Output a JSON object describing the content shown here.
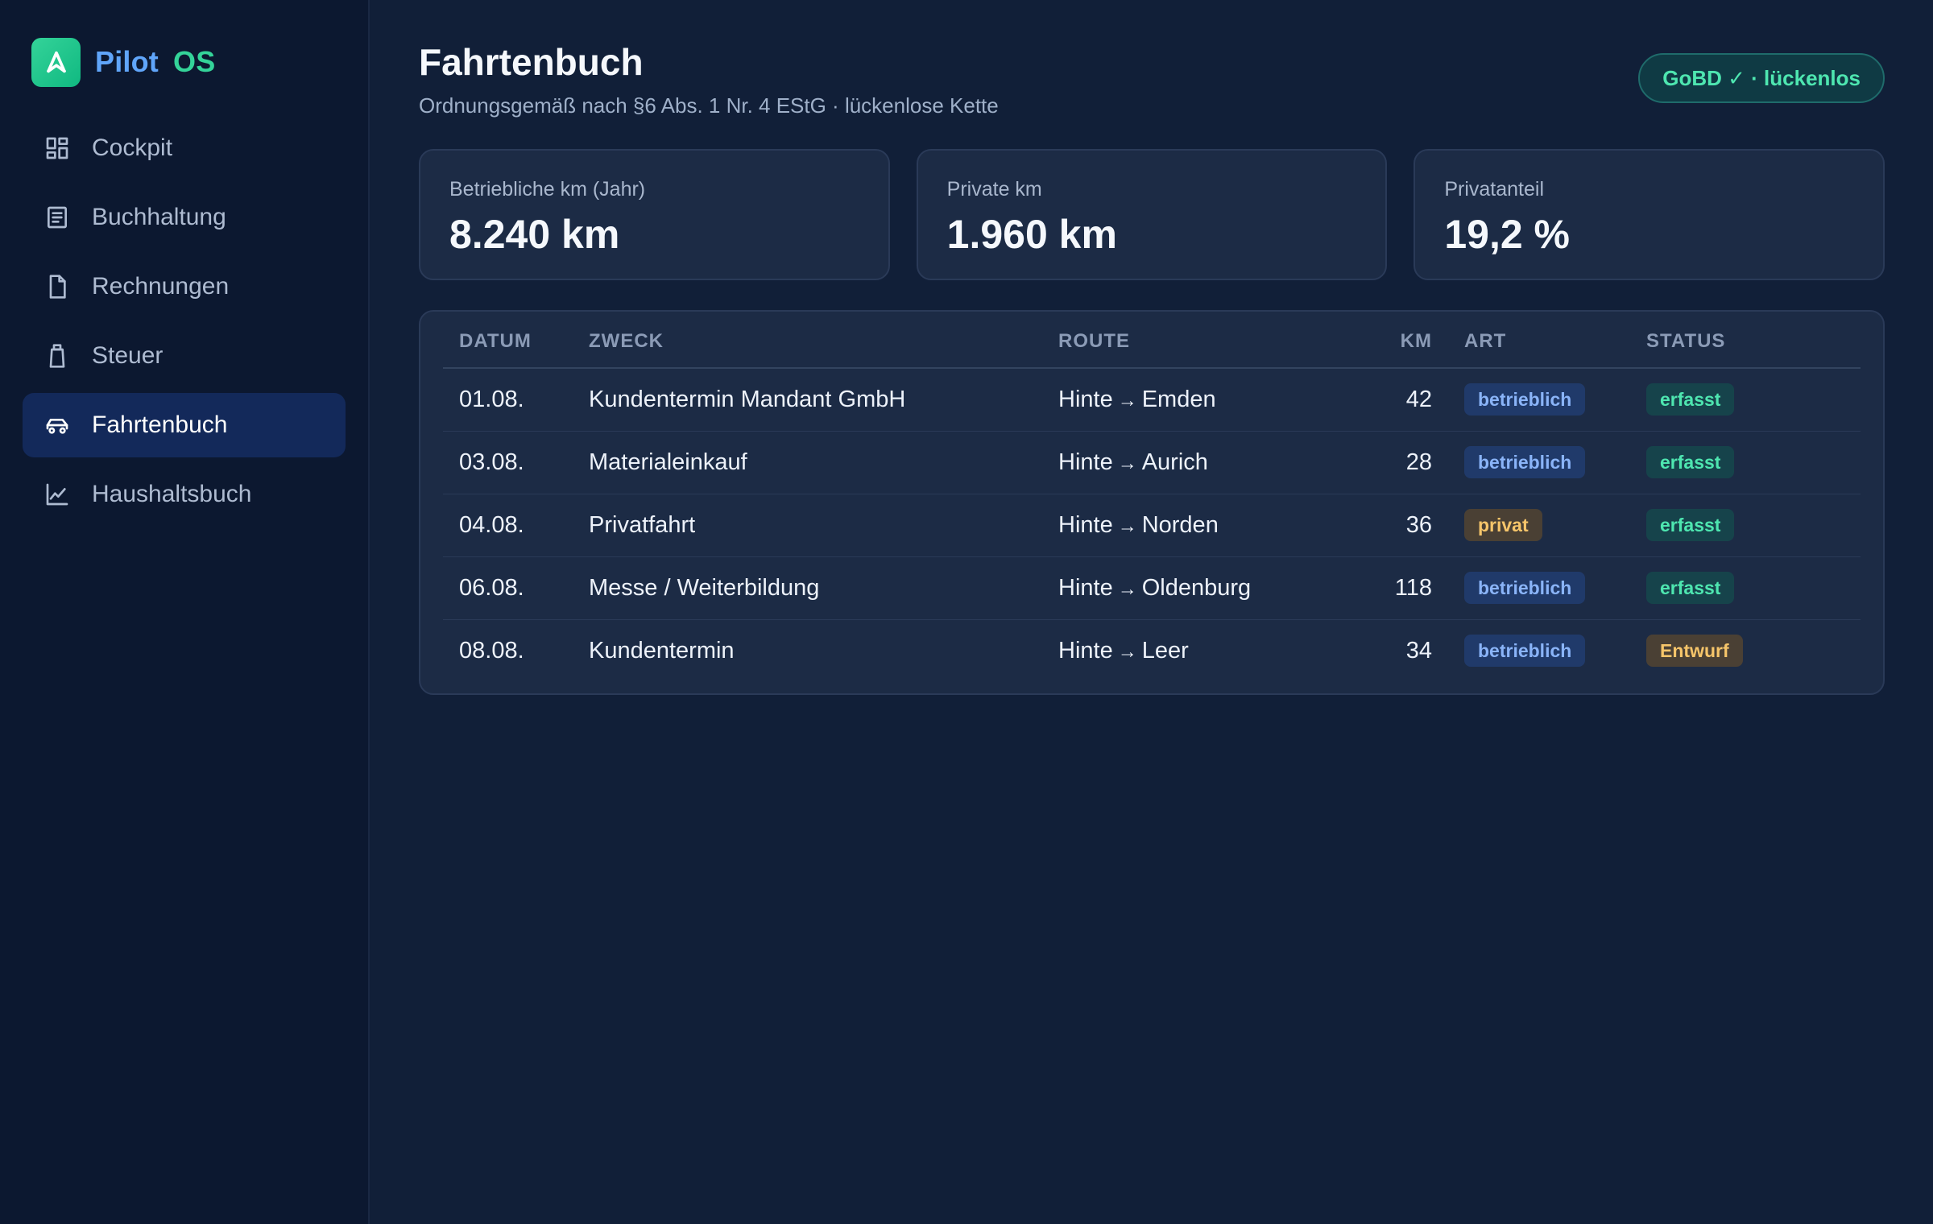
{
  "brand": {
    "part1": "Pilot",
    "part2": "OS"
  },
  "sidebar": {
    "items": [
      {
        "label": "Cockpit",
        "icon": "dashboard-icon"
      },
      {
        "label": "Buchhaltung",
        "icon": "ledger-icon"
      },
      {
        "label": "Rechnungen",
        "icon": "document-icon"
      },
      {
        "label": "Steuer",
        "icon": "tax-icon"
      },
      {
        "label": "Fahrtenbuch",
        "icon": "car-icon",
        "active": true
      },
      {
        "label": "Haushaltsbuch",
        "icon": "chart-line-icon"
      }
    ]
  },
  "header": {
    "title": "Fahrtenbuch",
    "subtitle": "Ordnungsgemäß nach §6 Abs. 1 Nr. 4 EStG · lückenlose Kette",
    "badge": "GoBD ✓ · lückenlos"
  },
  "stats": [
    {
      "label": "Betriebliche km (Jahr)",
      "value": "8.240 km"
    },
    {
      "label": "Private km",
      "value": "1.960 km"
    },
    {
      "label": "Privatanteil",
      "value": "19,2 %"
    }
  ],
  "table": {
    "columns": [
      "DATUM",
      "ZWECK",
      "ROUTE",
      "KM",
      "ART",
      "STATUS"
    ],
    "rows": [
      {
        "date": "01.08.",
        "purpose": "Kundentermin Mandant GmbH",
        "from": "Hinte",
        "arrow": "→",
        "to": "Emden",
        "km": "42",
        "art": "betrieblich",
        "status": "erfasst"
      },
      {
        "date": "03.08.",
        "purpose": "Materialeinkauf",
        "from": "Hinte",
        "arrow": "→",
        "to": "Aurich",
        "km": "28",
        "art": "betrieblich",
        "status": "erfasst"
      },
      {
        "date": "04.08.",
        "purpose": "Privatfahrt",
        "from": "Hinte",
        "arrow": "→",
        "to": "Norden",
        "km": "36",
        "art": "privat",
        "status": "erfasst"
      },
      {
        "date": "06.08.",
        "purpose": "Messe / Weiterbildung",
        "from": "Hinte",
        "arrow": "→",
        "to": "Oldenburg",
        "km": "118",
        "art": "betrieblich",
        "status": "erfasst"
      },
      {
        "date": "08.08.",
        "purpose": "Kundentermin",
        "from": "Hinte",
        "arrow": "→",
        "to": "Leer",
        "km": "34",
        "art": "betrieblich",
        "status": "Entwurf"
      }
    ]
  },
  "colors": {
    "accent_blue": "#60a5fa",
    "accent_green": "#34d399",
    "background": "#111f38",
    "sidebar": "#0c1830",
    "card": "#1c2b45"
  }
}
